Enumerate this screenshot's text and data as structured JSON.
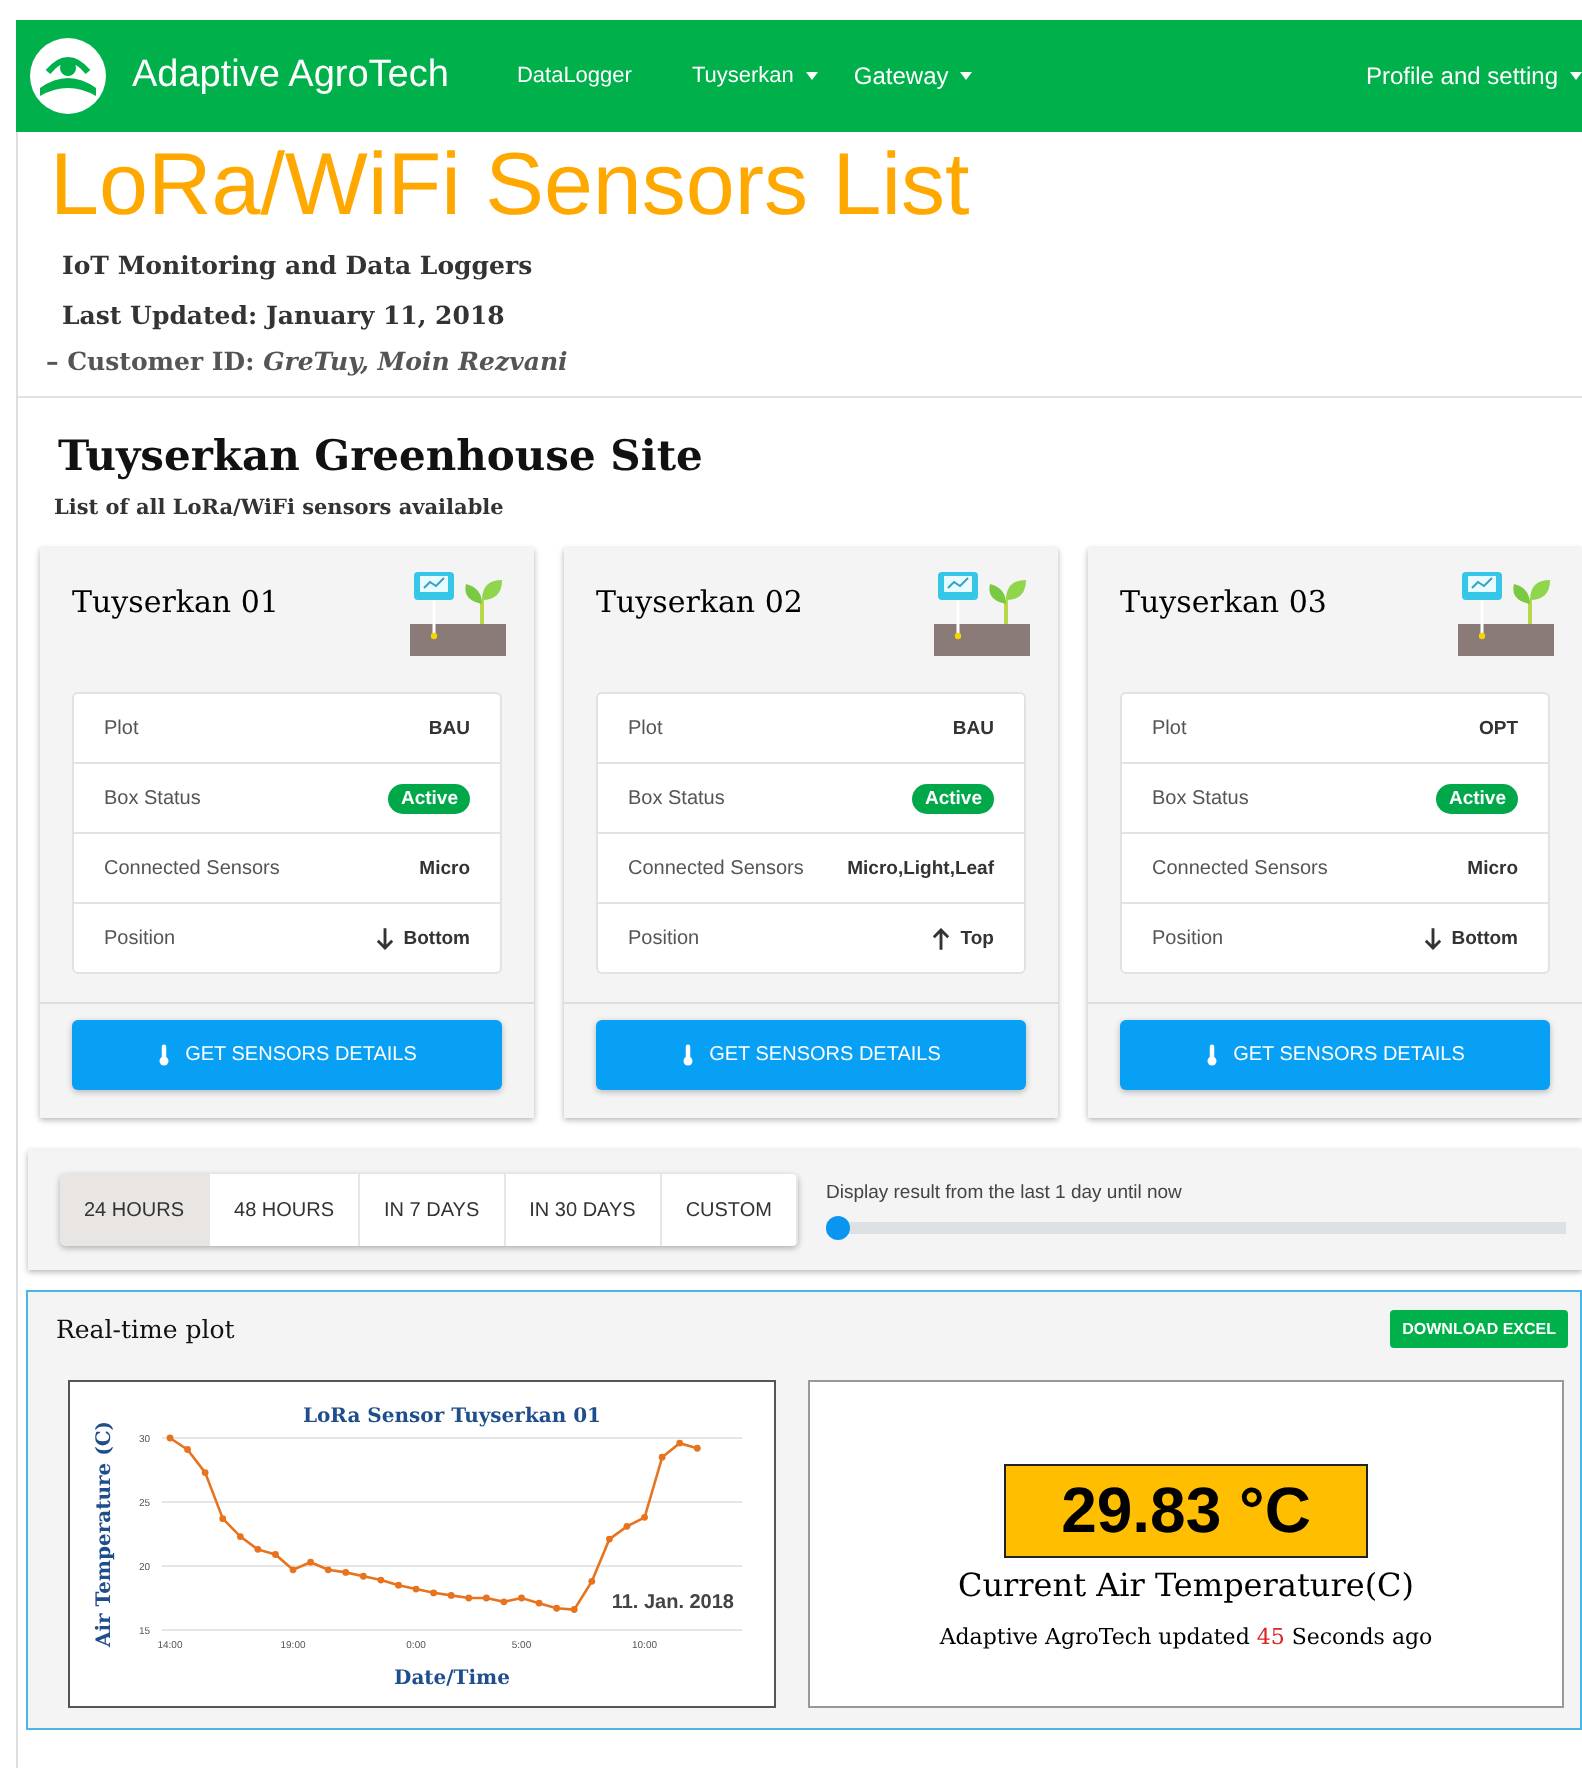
{
  "navbar": {
    "brand": "Adaptive AgroTech",
    "items": [
      {
        "label": "DataLogger",
        "dropdown": false
      },
      {
        "label": "Tuyserkan",
        "dropdown": true
      },
      {
        "label": "Gateway",
        "dropdown": true
      }
    ],
    "profile": {
      "label": "Profile and setting",
      "dropdown": true
    }
  },
  "header": {
    "title": "LoRa/WiFi Sensors List",
    "subtitle": "IoT Monitoring and Data Loggers",
    "updated": "Last Updated: January 11, 2018",
    "customer_label": "– Customer ID:",
    "customer_value": "GreTuy, Moin Rezvani"
  },
  "site": {
    "title": "Tuyserkan Greenhouse Site",
    "subtitle": "List of all LoRa/WiFi sensors available"
  },
  "cards": [
    {
      "name": "Tuyserkan 01",
      "rows": [
        {
          "label": "Plot",
          "value": "BAU",
          "kind": "text"
        },
        {
          "label": "Box Status",
          "value": "Active",
          "kind": "badge"
        },
        {
          "label": "Connected Sensors",
          "value": "Micro",
          "kind": "text"
        },
        {
          "label": "Position",
          "value": "Bottom",
          "kind": "down"
        }
      ],
      "button": "GET SENSORS DETAILS"
    },
    {
      "name": "Tuyserkan 02",
      "rows": [
        {
          "label": "Plot",
          "value": "BAU",
          "kind": "text"
        },
        {
          "label": "Box Status",
          "value": "Active",
          "kind": "badge"
        },
        {
          "label": "Connected Sensors",
          "value": "Micro,Light,Leaf",
          "kind": "text"
        },
        {
          "label": "Position",
          "value": "Top",
          "kind": "up"
        }
      ],
      "button": "GET SENSORS DETAILS"
    },
    {
      "name": "Tuyserkan 03",
      "rows": [
        {
          "label": "Plot",
          "value": "OPT",
          "kind": "text"
        },
        {
          "label": "Box Status",
          "value": "Active",
          "kind": "badge"
        },
        {
          "label": "Connected Sensors",
          "value": "Micro",
          "kind": "text"
        },
        {
          "label": "Position",
          "value": "Bottom",
          "kind": "down"
        }
      ],
      "button": "GET SENSORS DETAILS"
    }
  ],
  "range": {
    "tabs": [
      {
        "label": "24 HOURS",
        "selected": true
      },
      {
        "label": "48 HOURS",
        "selected": false
      },
      {
        "label": "IN 7 DAYS",
        "selected": false
      },
      {
        "label": "IN 30 DAYS",
        "selected": false
      },
      {
        "label": "CUSTOM",
        "selected": false
      }
    ],
    "slider_label": "Display result from the last 1 day until now",
    "level": 0
  },
  "plot_panel": {
    "title": "Real-time plot",
    "download": "DOWNLOAD EXCEL",
    "chart_data": {
      "type": "line",
      "title": "LoRa Sensor Tuyserkan 01",
      "xlabel": "Date/Time",
      "ylabel": "Air Temperature (C)",
      "annotations": [
        "11. Jan. 2018"
      ],
      "ylim": [
        15,
        30
      ],
      "yticks": [
        15,
        20,
        25,
        30
      ],
      "categories": [
        "14:00",
        null,
        null,
        null,
        null,
        null,
        null,
        "19:00",
        null,
        null,
        null,
        null,
        null,
        null,
        "0:00",
        null,
        null,
        null,
        null,
        null,
        "5:00",
        null,
        null,
        null,
        null,
        null,
        null,
        "10:00",
        null,
        null,
        null
      ],
      "series": [
        {
          "color": "#e8731e",
          "marker": "circle",
          "values": [
            30,
            29.1,
            27.3,
            23.7,
            22.3,
            21.3,
            20.9,
            19.7,
            20.3,
            19.7,
            19.5,
            19.2,
            18.9,
            18.5,
            18.2,
            17.9,
            17.7,
            17.5,
            17.5,
            17.2,
            17.5,
            17.1,
            16.7,
            16.6,
            18.8,
            22.1,
            23.1,
            23.8,
            28.5,
            29.6,
            29.2
          ]
        }
      ]
    },
    "reading": "29.83 °C",
    "reading_label": "Current Air Temperature(C)",
    "updated_prefix": "Adaptive AgroTech updated",
    "updated_seconds": "45",
    "updated_suffix": "Seconds ago"
  }
}
